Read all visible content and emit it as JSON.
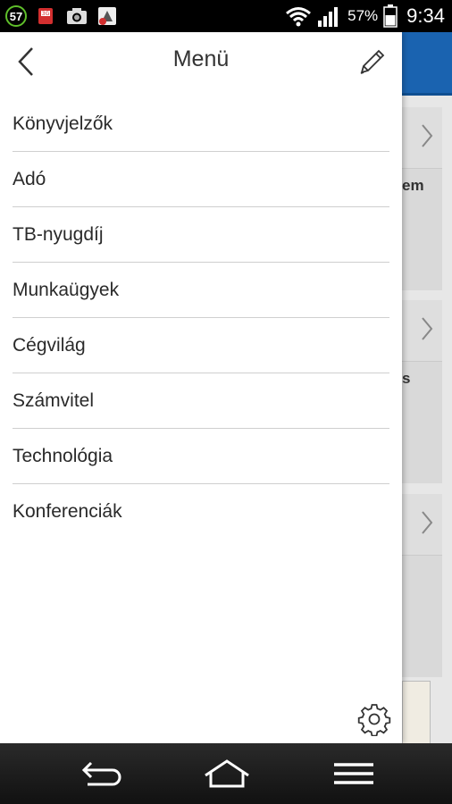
{
  "status_bar": {
    "notification_count": "57",
    "battery_percent": "57%",
    "time": "9:34",
    "icons": [
      "counter-badge-icon",
      "mobile-network-icon",
      "camera-icon",
      "app-notification-icon",
      "wifi-icon",
      "signal-icon",
      "battery-icon"
    ]
  },
  "drawer": {
    "title": "Menü",
    "items": [
      {
        "label": "Könyvjelzők"
      },
      {
        "label": "Adó"
      },
      {
        "label": "TB-nyugdíj"
      },
      {
        "label": "Munkaügyek"
      },
      {
        "label": "Cégvilág"
      },
      {
        "label": "Számvitel"
      },
      {
        "label": "Technológia"
      },
      {
        "label": "Konferenciák"
      }
    ]
  },
  "background": {
    "card_texts": [
      "em",
      "s"
    ]
  },
  "colors": {
    "accent": "#1a63b0",
    "status_bar": "#000000",
    "drawer_bg": "#ffffff",
    "divider": "#cfcfcf"
  }
}
